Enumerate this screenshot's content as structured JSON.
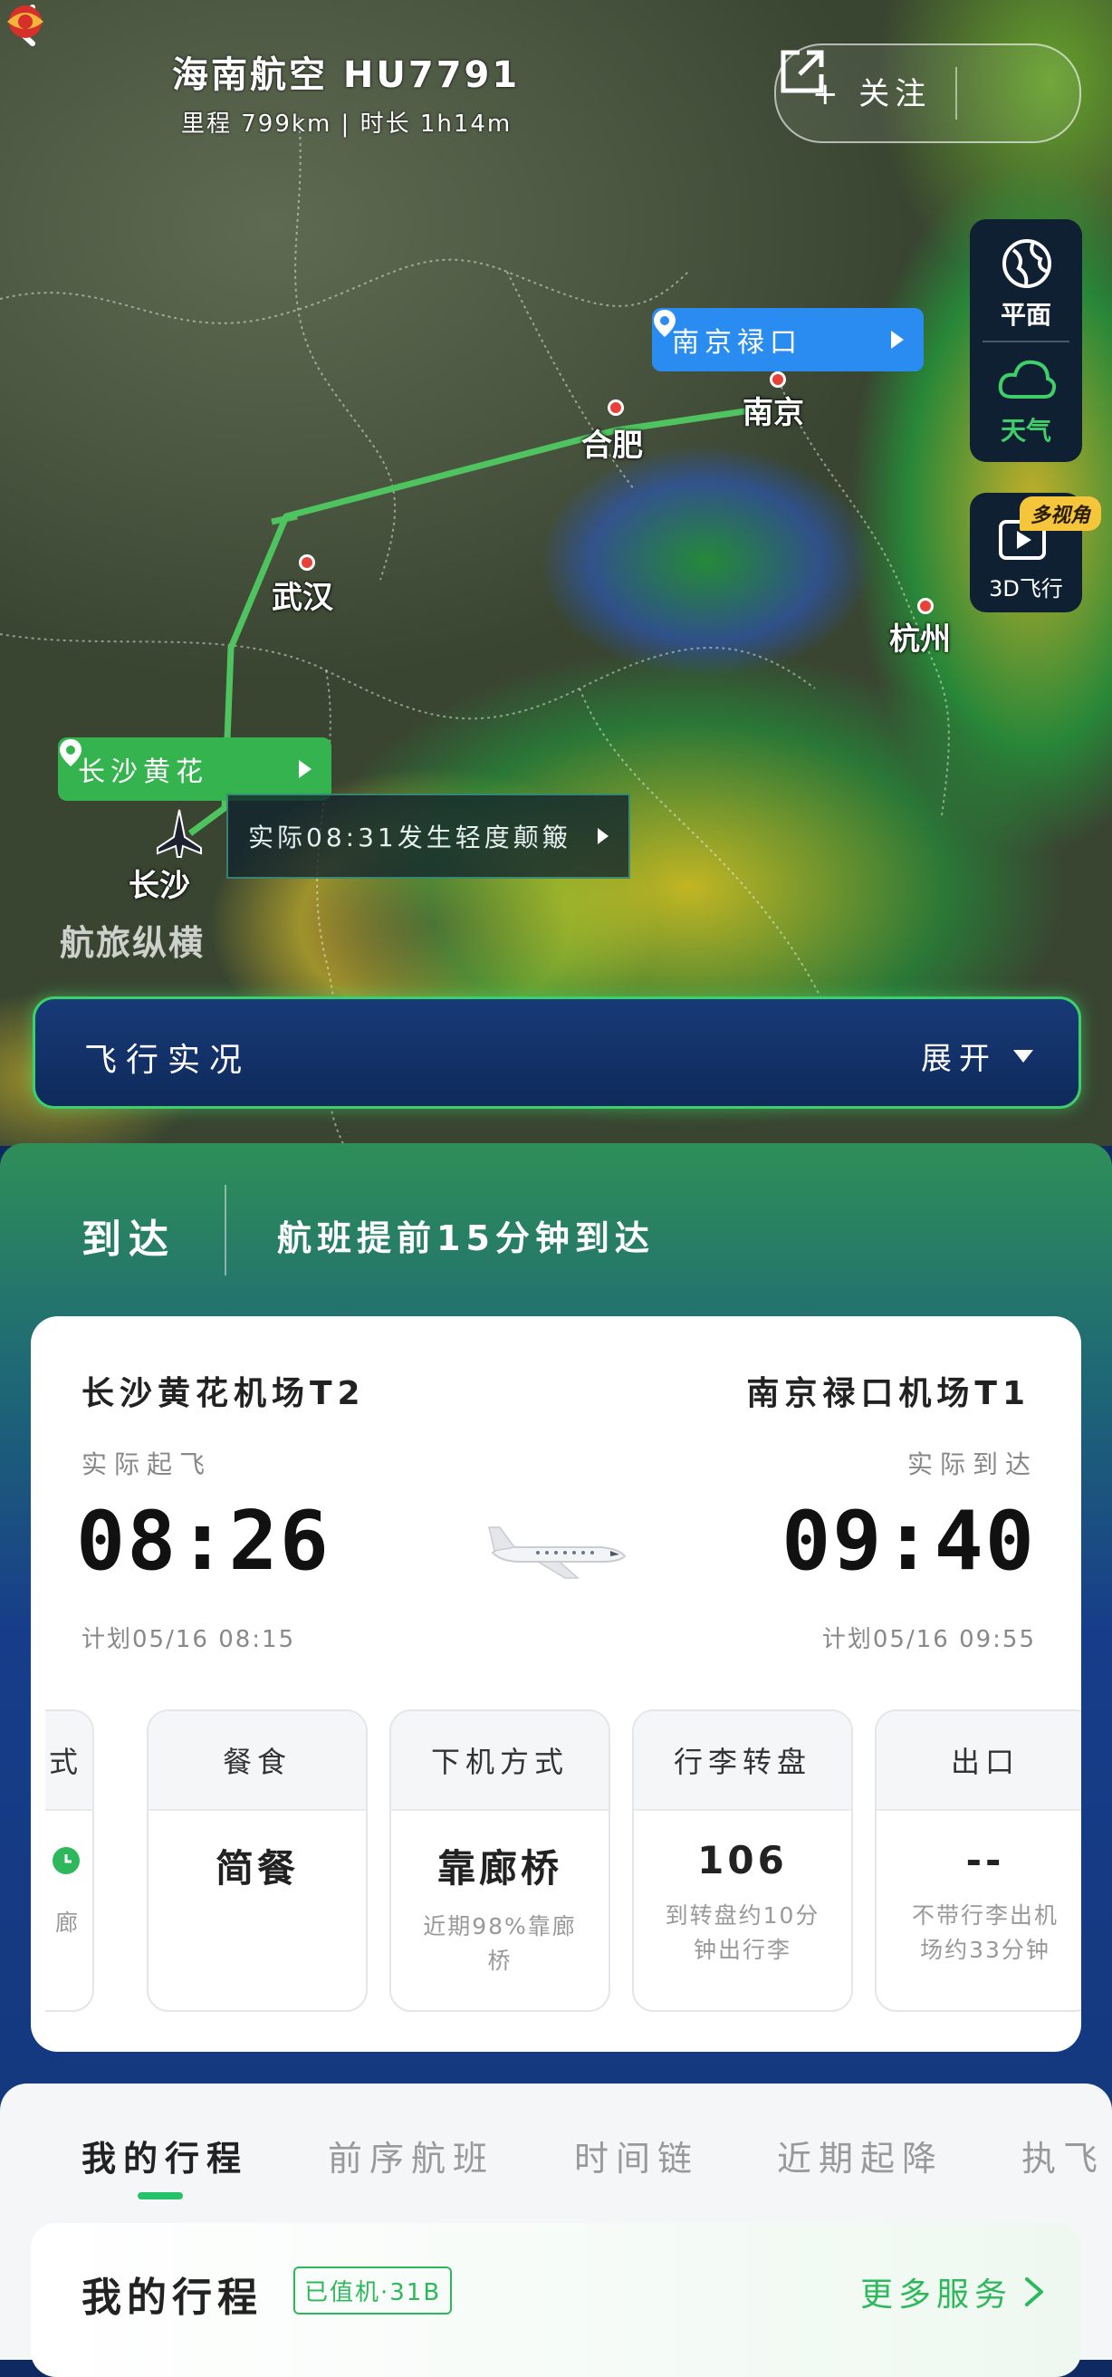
{
  "header": {
    "airline": "海南航空 HU7791",
    "stats": "里程 799km | 时长 1h14m",
    "follow_label": "+ 关注"
  },
  "map": {
    "cities": [
      "合肥",
      "南京",
      "武汉",
      "杭州",
      "长沙"
    ],
    "watermark": "航旅纵横",
    "origin_tag": "长沙黄花",
    "dest_tag": "南京禄口",
    "turbulence": "实际08:31发生轻度颠簸"
  },
  "side_controls": {
    "plane_view": "平面",
    "weather": "天气",
    "three_d": "3D飞行",
    "multi_view": "多视角"
  },
  "live_bar": {
    "title": "飞行实况",
    "expand": "展开"
  },
  "arrival": {
    "label": "到达",
    "message": "航班提前15分钟到达"
  },
  "flight": {
    "dep_airport": "长沙黄花机场T2",
    "arr_airport": "南京禄口机场T1",
    "dep_label": "实际起飞",
    "arr_label": "实际到达",
    "dep_time": "08:26",
    "arr_time": "09:40",
    "dep_plan": "计划05/16 08:15",
    "arr_plan": "计划05/16 09:55"
  },
  "info_cards": [
    {
      "head": "餐食",
      "value": "简餐",
      "sub": ""
    },
    {
      "head": "下机方式",
      "value": "靠廊桥",
      "sub": "近期98%靠廊桥"
    },
    {
      "head": "行李转盘",
      "value": "106",
      "sub": "到转盘约10分钟出行李"
    },
    {
      "head": "出口",
      "value": "--",
      "sub": "不带行李出机场约33分钟"
    }
  ],
  "partial_card": {
    "head": "式",
    "sub": "廊"
  },
  "tabs": [
    "我的行程",
    "前序航班",
    "时间链",
    "近期起降",
    "执飞"
  ],
  "trip": {
    "title": "我的行程",
    "checkin": "已值机·31B",
    "more": "更多服务"
  },
  "colors": {
    "accent_green": "#2eb85c",
    "route_green": "#4fc35f",
    "tag_blue": "#2a8cf0",
    "panel_blue": "#133678"
  }
}
